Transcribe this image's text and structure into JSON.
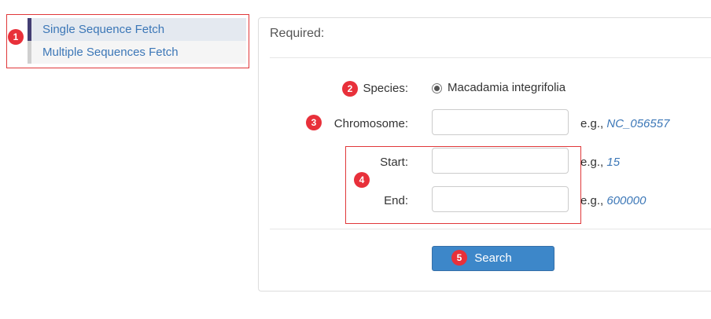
{
  "nav": {
    "items": [
      {
        "label": "Single Sequence Fetch",
        "active": true
      },
      {
        "label": "Multiple Sequences Fetch",
        "active": false
      }
    ]
  },
  "badges": [
    "1",
    "2",
    "3",
    "4",
    "5"
  ],
  "panel": {
    "title": "Required:",
    "species": {
      "label": "Species:",
      "option": "Macadamia integrifolia",
      "selected": true
    },
    "chromosome": {
      "label": "Chromosome:",
      "value": "",
      "example_prefix": "e.g.,",
      "example": "NC_056557"
    },
    "start": {
      "label": "Start:",
      "value": "",
      "example_prefix": "e.g.,",
      "example": "15"
    },
    "end": {
      "label": "End:",
      "value": "",
      "example_prefix": "e.g.,",
      "example": "600000"
    },
    "search_label": "Search"
  },
  "colors": {
    "accent": "#3d87c9",
    "link": "#3c77b7",
    "highlight_border": "#e0383a",
    "badge": "#e8303a",
    "active_nav_bar": "#433e73"
  }
}
